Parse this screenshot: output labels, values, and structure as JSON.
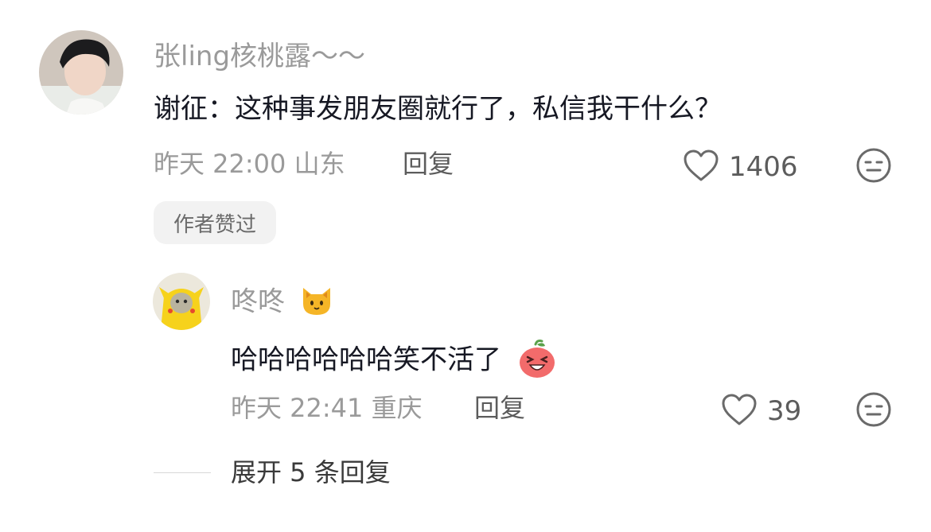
{
  "comment": {
    "username": "张ling核桃露～～",
    "text": "谢征：这种事发朋友圈就行了，私信我干什么？",
    "time": "昨天 22:00 山东",
    "reply_label": "回复",
    "likes": "1406",
    "badge": "作者赞过"
  },
  "reply": {
    "username": "咚咚",
    "username_emoji": "🐱",
    "text": "哈哈哈哈哈哈笑不活了",
    "time": "昨天 22:41 重庆",
    "reply_label": "回复",
    "likes": "39"
  },
  "expand": {
    "label": "展开 5 条回复"
  },
  "colors": {
    "meta_gray": "#9a9a9a",
    "text_dark": "#161823",
    "badge_bg": "#f2f2f2"
  }
}
